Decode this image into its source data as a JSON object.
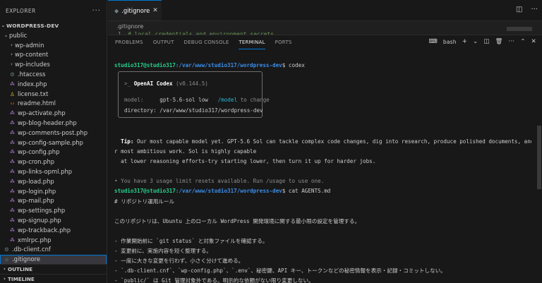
{
  "explorer": {
    "title": "EXPLORER",
    "root": "WORDPRESS-DEV",
    "public_folder": "public",
    "items": [
      {
        "label": "wp-admin",
        "kind": "folder"
      },
      {
        "label": "wp-content",
        "kind": "folder"
      },
      {
        "label": "wp-includes",
        "kind": "folder"
      },
      {
        "label": ".htaccess",
        "kind": "gear"
      },
      {
        "label": "index.php",
        "kind": "php"
      },
      {
        "label": "license.txt",
        "kind": "license"
      },
      {
        "label": "readme.html",
        "kind": "readme"
      },
      {
        "label": "wp-activate.php",
        "kind": "php"
      },
      {
        "label": "wp-blog-header.php",
        "kind": "php"
      },
      {
        "label": "wp-comments-post.php",
        "kind": "php"
      },
      {
        "label": "wp-config-sample.php",
        "kind": "php"
      },
      {
        "label": "wp-config.php",
        "kind": "php"
      },
      {
        "label": "wp-cron.php",
        "kind": "php"
      },
      {
        "label": "wp-links-opml.php",
        "kind": "php"
      },
      {
        "label": "wp-load.php",
        "kind": "php"
      },
      {
        "label": "wp-login.php",
        "kind": "php"
      },
      {
        "label": "wp-mail.php",
        "kind": "php"
      },
      {
        "label": "wp-settings.php",
        "kind": "php"
      },
      {
        "label": "wp-signup.php",
        "kind": "php"
      },
      {
        "label": "wp-trackback.php",
        "kind": "php"
      },
      {
        "label": "xmlrpc.php",
        "kind": "php"
      }
    ],
    "db_client": ".db-client.cnf",
    "gitignore": ".gitignore",
    "outline": "OUTLINE",
    "timeline": "TIMELINE"
  },
  "editor": {
    "tab_label": ".gitignore",
    "breadcrumb": ".gitignore",
    "line_number": "1",
    "line_text": "# local credentials and environment secrets"
  },
  "panel": {
    "tabs": [
      "PROBLEMS",
      "OUTPUT",
      "DEBUG CONSOLE",
      "TERMINAL",
      "PORTS"
    ],
    "active_tab": "TERMINAL",
    "shell": "bash"
  },
  "terminal": {
    "prompt_user": "studio317@studio317",
    "prompt_path": ":/var/www/studio317/wordpress-dev",
    "prompt_suffix": "$ ",
    "cmd1": "codex",
    "box_prefix": ">_ ",
    "box_title": "OpenAI Codex",
    "box_version": " (v0.144.5)",
    "model_key": "model:     ",
    "model_value": "gpt-5.6-sol low   ",
    "model_cmd": "/model",
    "model_hint": " to change",
    "dir_line": "directory: /var/www/studio317/wordpress-dev",
    "tip_label": "Tip:",
    "tip_text1": " Our most capable model yet. GPT-5.6 Sol can tackle complex code changes, dig into research, produce polished documents, and take on you",
    "tip_text2": "r most ambitious work. Sol is highly capable",
    "tip_text3": "at lower reasoning efforts-try starting lower, then turn it up for harder jobs.",
    "usage_line": "• You have 3 usage limit resets available. Run /usage to use one.",
    "cmd2": "cat AGENTS.md",
    "md_heading": "# リポジトリ運用ルール",
    "md_intro": "このリポジトリは、Ubuntu 上のローカル WordPress 開発環境に関する最小限の設定を管理する。",
    "md_rules": [
      "- 作業開始前に `git status` と対象ファイルを確認する。",
      "- 変更前に、実施内容を短く整理する。",
      "- 一度に大きな変更を行わず、小さく分けて進める。",
      "- `.db-client.cnf`、`wp-config.php`、`.env`、秘密鍵、API キー、トークンなどの秘密情報を表示・記録・コミットしない。",
      "- `public/` は Git 管理対象外である。明示的な依頼がない限り変更しない。"
    ]
  }
}
